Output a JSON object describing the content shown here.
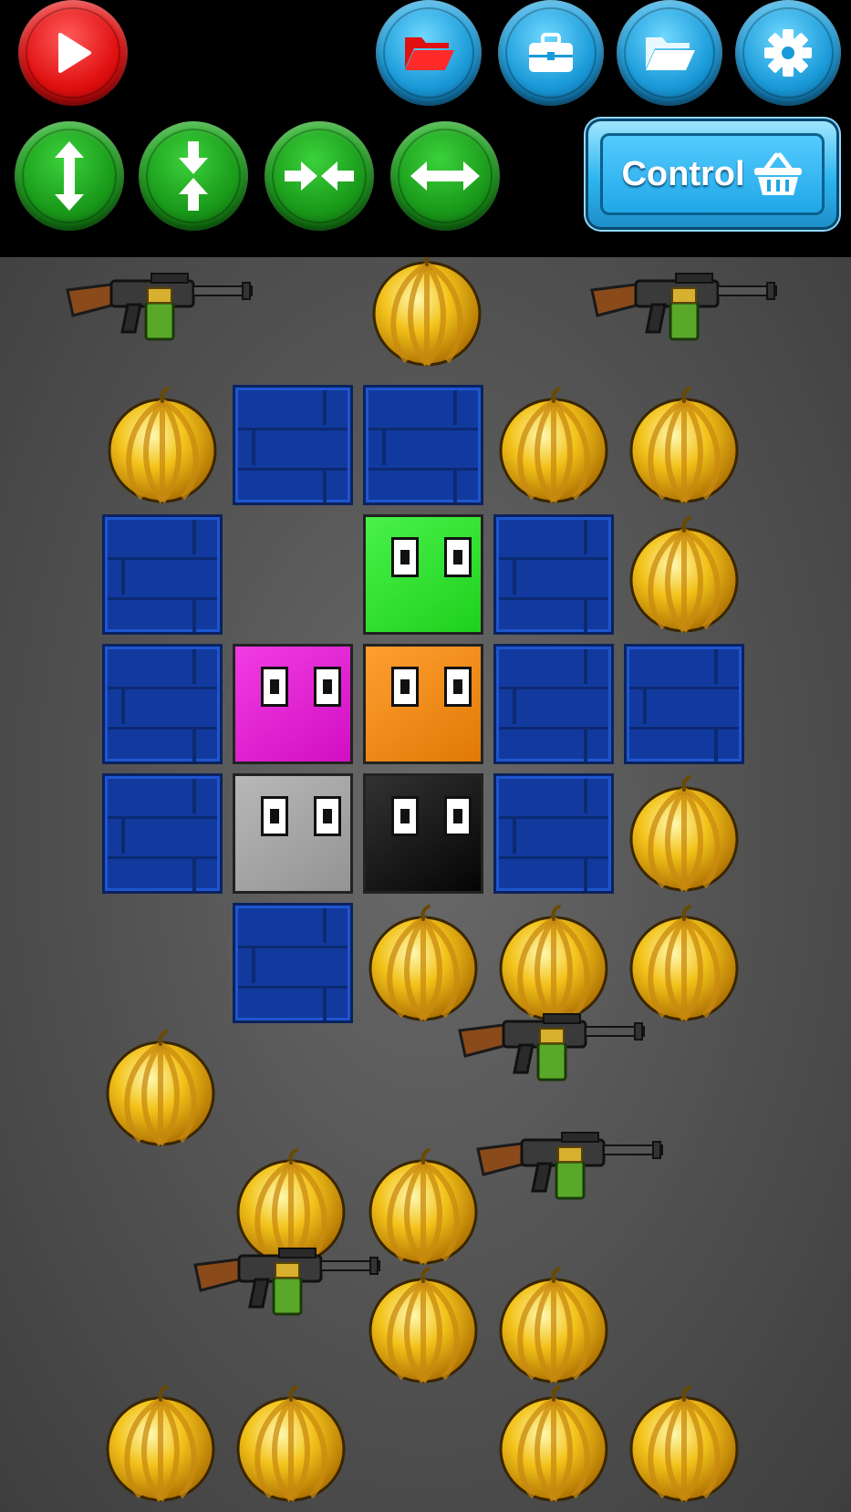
{
  "toolbar": {
    "play_icon": "play-icon",
    "top_buttons": [
      {
        "name": "open-red-folder-button",
        "icon": "folder-open-icon"
      },
      {
        "name": "briefcase-button",
        "icon": "briefcase-icon"
      },
      {
        "name": "open-folder-button",
        "icon": "folder-open-icon"
      },
      {
        "name": "settings-button",
        "icon": "gear-icon"
      }
    ],
    "move_buttons": [
      {
        "name": "expand-vertical-button",
        "icon": "arrows-expand-vertical-icon"
      },
      {
        "name": "compress-vertical-button",
        "icon": "arrows-compress-vertical-icon"
      },
      {
        "name": "compress-horizontal-button",
        "icon": "arrows-compress-horizontal-icon"
      },
      {
        "name": "expand-horizontal-button",
        "icon": "arrows-expand-horizontal-icon"
      }
    ],
    "control_label": "Control",
    "control_icon": "basket-icon"
  },
  "board": {
    "colors": {
      "background": "#555555",
      "brick": "#123a9e",
      "melon": "#f2c21a",
      "green_blob": "#22ee22",
      "magenta_blob": "#ee11dd",
      "orange_blob": "#ff8a05",
      "gray_blob": "#a8a8a8",
      "black_blob": "#050505"
    },
    "blobs": [
      "green",
      "magenta",
      "orange",
      "gray",
      "black"
    ],
    "item_types": [
      "brick",
      "melon",
      "machine-gun",
      "blob"
    ]
  }
}
